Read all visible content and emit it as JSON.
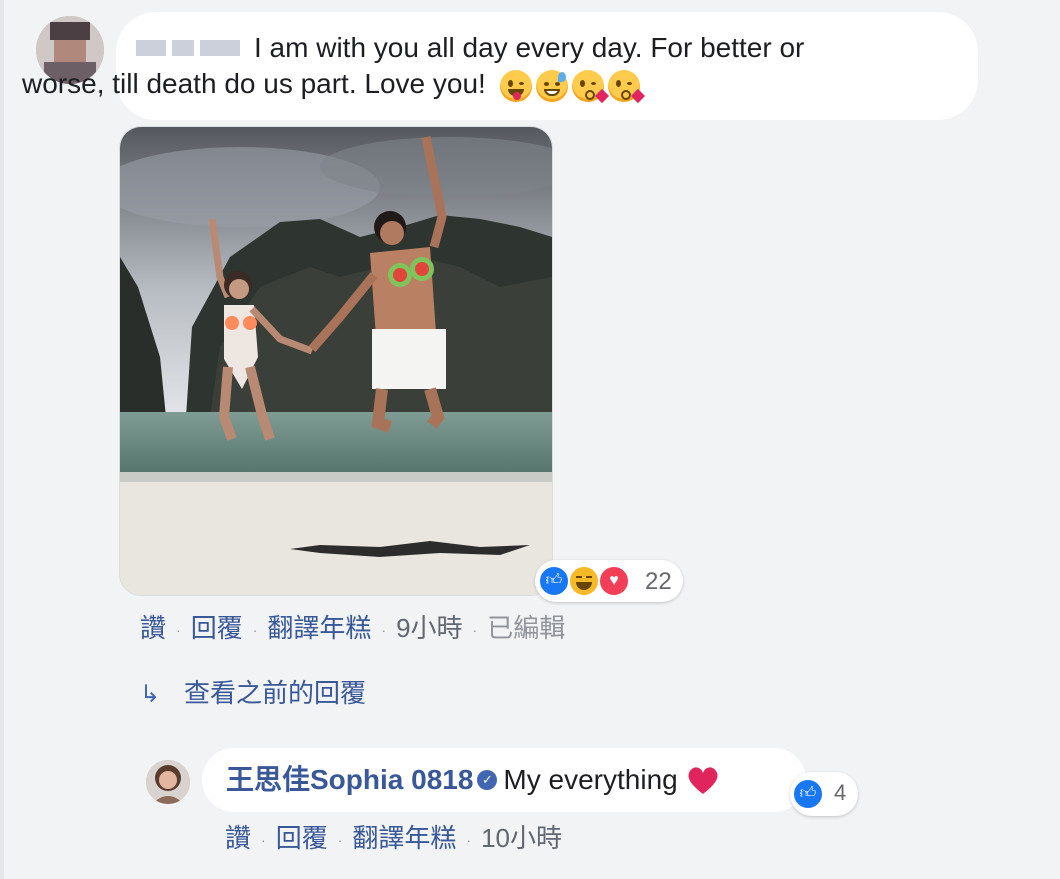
{
  "comment": {
    "text_line1": "I am with you all day every day. For better or",
    "text_line2": "worse, till death do us part. Love you!",
    "emojis": [
      "winking-tongue-emoji",
      "grinning-sweat-emoji",
      "kissing-heart-emoji",
      "kissing-heart-emoji"
    ]
  },
  "reactions": {
    "icons": [
      "like-icon",
      "haha-icon",
      "love-icon"
    ],
    "count": "22"
  },
  "actions": {
    "like": "讚",
    "reply": "回覆",
    "translate": "翻譯年糕",
    "time": "9小時",
    "edited": "已編輯"
  },
  "view_previous_replies": "查看之前的回覆",
  "reply": {
    "author": "王思佳Sophia 0818",
    "text": "My everything",
    "reaction_count": "4",
    "actions": {
      "like": "讚",
      "reply": "回覆",
      "translate": "翻譯年糕",
      "time": "10小時"
    }
  },
  "colors": {
    "link": "#385898",
    "like": "#1877f2",
    "love": "#f33e58",
    "haha": "#f7b928",
    "background": "#f2f3f5"
  }
}
